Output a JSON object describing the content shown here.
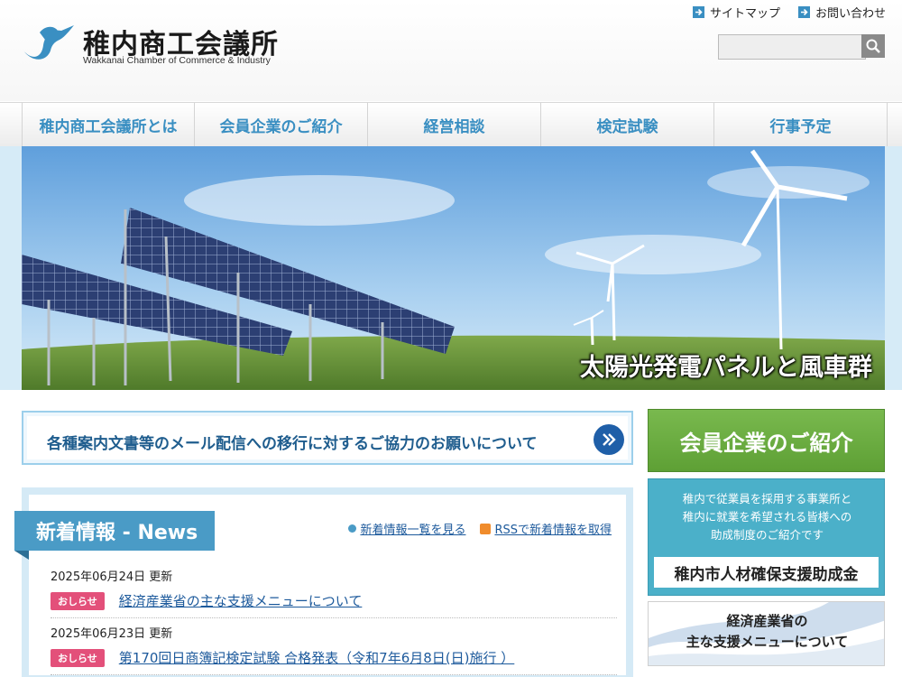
{
  "header": {
    "logo_title": "稚内商工会議所",
    "logo_subtitle": "Wakkanai Chamber of Commerce & Industry",
    "util_links": [
      "サイトマップ",
      "お問い合わせ"
    ],
    "search_placeholder": ""
  },
  "nav": {
    "items": [
      "稚内商工会議所とは",
      "会員企業のご紹介",
      "経営相談",
      "検定試験",
      "行事予定"
    ]
  },
  "hero": {
    "caption": "太陽光発電パネルと風車群"
  },
  "banner": {
    "text": "各種案内文書等のメール配信への移行に対するご協力のお願いについて"
  },
  "news": {
    "heading": "新着情報 - News",
    "list_link": "新着情報一覧を見る",
    "rss_link": "RSSで新着情報を取得",
    "entries": [
      {
        "date": "2025年06月24日 更新",
        "tag": "おしらせ",
        "title": "経済産業省の主な支援メニューについて"
      },
      {
        "date": "2025年06月23日 更新",
        "tag": "おしらせ",
        "title": "第170回日商簿記検定試験 合格発表（令和7年6月8日(日)施行 ）"
      }
    ]
  },
  "sidebar": {
    "member_button": "会員企業のご紹介",
    "grant": {
      "desc": [
        "稚内で従業員を採用する事業所と",
        "稚内に就業を希望される皆様への",
        "助成制度のご紹介です"
      ],
      "title": "稚内市人材確保支援助成金"
    },
    "meti": {
      "lines": [
        "経済産業省の",
        "主な支援メニューについて"
      ]
    }
  },
  "colors": {
    "accent_blue": "#3a8fc2",
    "tag_pink": "#e3507a",
    "member_green": "#6aac40",
    "grant_teal": "#4bb0c9"
  }
}
